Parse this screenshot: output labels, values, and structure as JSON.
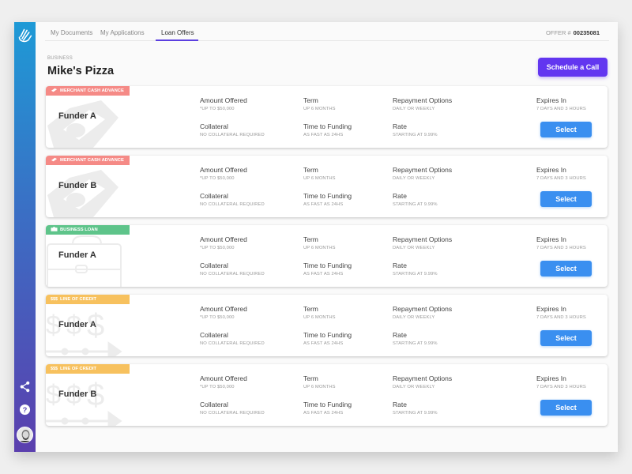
{
  "nav": {
    "tabs": [
      {
        "label": "My Documents"
      },
      {
        "label": "My Applications"
      },
      {
        "label": "Loan Offers",
        "active": true
      }
    ],
    "offer_label": "OFFER #",
    "offer_number": "00235081"
  },
  "sidebar": {
    "icons": [
      "logo-hand-icon",
      "share-icon",
      "help-icon",
      "user-avatar"
    ]
  },
  "business": {
    "label": "BUSINESS",
    "name": "Mike's Pizza"
  },
  "schedule_button": "Schedule a Call",
  "colors": {
    "accent_purple": "#6236f0",
    "select_blue": "#3a8ff0",
    "badge_mca": "#f58a86",
    "badge_loan": "#5ec48a",
    "badge_credit": "#f7c15e"
  },
  "offers": [
    {
      "type": "MERCHANT CASH ADVANCE",
      "funder": "Funder A",
      "amount_label": "Amount Offered",
      "amount": "*UP TO $50,000",
      "term_label": "Term",
      "term": "UP 6 MONTHS",
      "repayment_label": "Repayment Options",
      "repayment": "DAILY OR WEEKLY",
      "expires_label": "Expires In",
      "expires": "7 DAYS AND 3 HOURS",
      "collateral_label": "Collateral",
      "collateral": "NO COLLATERAL REQUIRED",
      "funding_label": "Time to Funding",
      "funding": "AS FAST AS 24HS",
      "rate_label": "Rate",
      "rate": "STARTING AT 9.99%",
      "select": "Select"
    },
    {
      "type": "MERCHANT CASH ADVANCE",
      "funder": "Funder B",
      "amount_label": "Amount Offered",
      "amount": "*UP TO $50,000",
      "term_label": "Term",
      "term": "UP 6 MONTHS",
      "repayment_label": "Repayment Options",
      "repayment": "DAILY OR WEEKLY",
      "expires_label": "Expires In",
      "expires": "7 DAYS AND 3 HOURS",
      "collateral_label": "Collateral",
      "collateral": "NO COLLATERAL REQUIRED",
      "funding_label": "Time to Funding",
      "funding": "AS FAST AS 24HS",
      "rate_label": "Rate",
      "rate": "STARTING AT 9.99%",
      "select": "Select"
    },
    {
      "type": "BUSINESS LOAN",
      "funder": "Funder A",
      "amount_label": "Amount Offered",
      "amount": "*UP TO $50,000",
      "term_label": "Term",
      "term": "UP 6 MONTHS",
      "repayment_label": "Repayment Options",
      "repayment": "DAILY OR WEEKLY",
      "expires_label": "Expires In",
      "expires": "7 DAYS AND 3 HOURS",
      "collateral_label": "Collateral",
      "collateral": "NO COLLATERAL REQUIRED",
      "funding_label": "Time to Funding",
      "funding": "AS FAST AS 24HS",
      "rate_label": "Rate",
      "rate": "STARTING AT 9.99%",
      "select": "Select"
    },
    {
      "type": "LINE OF CREDIT",
      "funder": "Funder A",
      "amount_label": "Amount Offered",
      "amount": "*UP TO $50,000",
      "term_label": "Term",
      "term": "UP 6 MONTHS",
      "repayment_label": "Repayment Options",
      "repayment": "DAILY OR WEEKLY",
      "expires_label": "Expires In",
      "expires": "7 DAYS AND 3 HOURS",
      "collateral_label": "Collateral",
      "collateral": "NO COLLATERAL REQUIRED",
      "funding_label": "Time to Funding",
      "funding": "AS FAST AS 24HS",
      "rate_label": "Rate",
      "rate": "STARTING AT 9.99%",
      "select": "Select"
    },
    {
      "type": "LINE OF CREDIT",
      "funder": "Funder B",
      "amount_label": "Amount Offered",
      "amount": "*UP TO $50,000",
      "term_label": "Term",
      "term": "UP 6 MONTHS",
      "repayment_label": "Repayment Options",
      "repayment": "DAILY OR WEEKLY",
      "expires_label": "Expires In",
      "expires": "7 DAYS AND 3 HOURS",
      "collateral_label": "Collateral",
      "collateral": "NO COLLATERAL REQUIRED",
      "funding_label": "Time to Funding",
      "funding": "AS FAST AS 24HS",
      "rate_label": "Rate",
      "rate": "STARTING AT 9.99%",
      "select": "Select"
    }
  ]
}
